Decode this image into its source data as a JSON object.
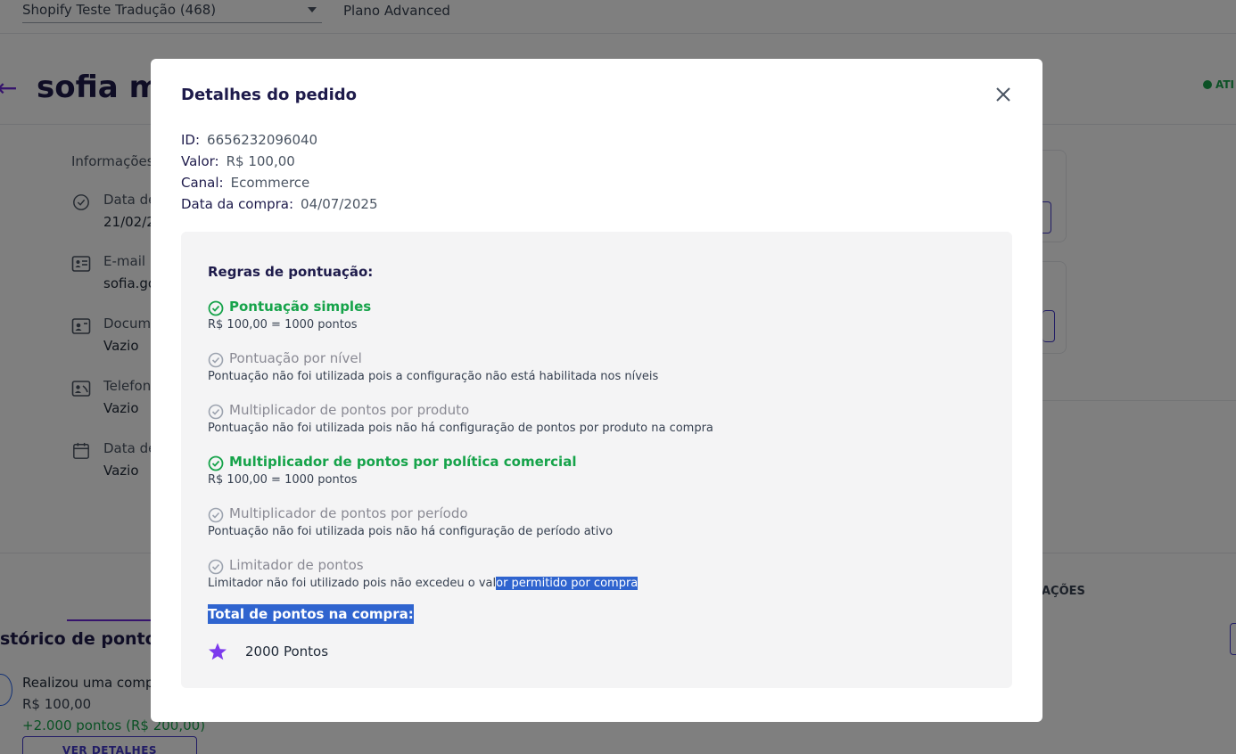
{
  "topbar": {
    "store_name": "Shopify Teste Tradução (468)",
    "plan": "Plano Advanced"
  },
  "customer": {
    "name_partial": "sofia m",
    "status_partial": "ATI"
  },
  "info": {
    "title_partial": "Informações",
    "rows": [
      {
        "icon": "check-circle-icon",
        "label": "Data de",
        "value": "21/02/2"
      },
      {
        "icon": "id-card-icon",
        "label": "E-mail",
        "value": "sofia.go"
      },
      {
        "icon": "contact-card-icon",
        "label": "Docume",
        "value": "Vazio"
      },
      {
        "icon": "phone-card-icon",
        "label": "Telefon",
        "value": "Vazio"
      },
      {
        "icon": "calendar-icon",
        "label": "Data de",
        "value": "Vazio"
      }
    ]
  },
  "actions_tab_partial": "AÇÕES",
  "history": {
    "title_partial": "stórico de pontos",
    "item_description": "Realizou uma compr",
    "item_value": "R$ 100,00",
    "item_points": "+2.000 pontos (R$ 200,00)",
    "details_button": "VER DETALHES"
  },
  "modal": {
    "title": "Detalhes do pedido",
    "close_icon": "close-icon",
    "fields": [
      {
        "key": "ID:",
        "value": "6656232096040"
      },
      {
        "key": "Valor:",
        "value": "R$ 100,00"
      },
      {
        "key": "Canal:",
        "value": "Ecommerce"
      },
      {
        "key": "Data da compra:",
        "value": "04/07/2025"
      }
    ],
    "rules_title": "Regras de pontuação:",
    "rules": [
      {
        "name": "Pontuação simples",
        "active": true,
        "description": "R$ 100,00 = 1000 pontos"
      },
      {
        "name": "Pontuação por nível",
        "active": false,
        "description": "Pontuação não foi utilizada pois a configuração não está habilitada nos níveis"
      },
      {
        "name": "Multiplicador de pontos por produto",
        "active": false,
        "description": "Pontuação não foi utilizada pois não há configuração de pontos por produto na compra"
      },
      {
        "name": "Multiplicador de pontos por política comercial",
        "active": true,
        "description": "R$ 100,00 = 1000 pontos"
      },
      {
        "name": "Multiplicador de pontos por período",
        "active": false,
        "description": "Pontuação não foi utilizada pois não há configuração de período ativo"
      },
      {
        "name": "Limitador de pontos",
        "active": false,
        "description_plain": "Limitador não foi utilizado pois não excedeu o val",
        "description_selected": "or permitido por compra"
      }
    ],
    "total_title": "Total de pontos na compra:",
    "total_points": "2000 Pontos",
    "colors": {
      "active": "#16a34a",
      "inactive": "#8a8a94",
      "selection": "#2f64cf",
      "star": "#7c3aed"
    }
  }
}
